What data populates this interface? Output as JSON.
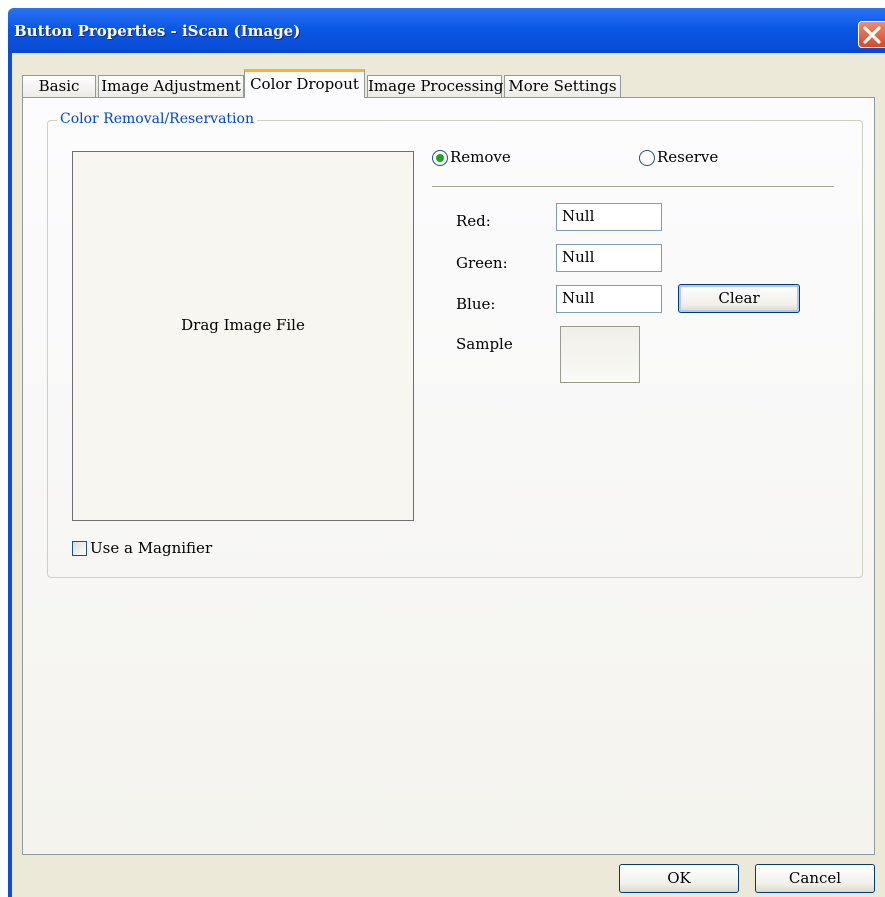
{
  "window": {
    "title": "Button Properties - iScan (Image)"
  },
  "tabs": [
    {
      "label": "Basic",
      "active": false
    },
    {
      "label": "Image Adjustment",
      "active": false
    },
    {
      "label": "Color Dropout",
      "active": true
    },
    {
      "label": "Image Processing",
      "active": false
    },
    {
      "label": "More Settings",
      "active": false
    }
  ],
  "color_removal": {
    "group_label": "Color Removal/Reservation",
    "drop_zone_text": "Drag Image File",
    "magnifier_label": "Use a Magnifier",
    "magnifier_checked": false,
    "mode_options": [
      {
        "label": "Remove",
        "selected": true
      },
      {
        "label": "Reserve",
        "selected": false
      }
    ],
    "fields": {
      "red": {
        "label": "Red:",
        "value": "Null"
      },
      "green": {
        "label": "Green:",
        "value": "Null"
      },
      "blue": {
        "label": "Blue:",
        "value": "Null"
      }
    },
    "clear_label": "Clear",
    "sample_label": "Sample"
  },
  "footer": {
    "ok_label": "OK",
    "cancel_label": "Cancel"
  },
  "colors": {
    "titlebar": "#0b58e6",
    "dialog_bg": "#ece9d8",
    "active_tab_accent": "#f9b132",
    "group_label": "#0046d5",
    "radio_dot": "#21a121",
    "close_button": "#d6482b"
  },
  "icons": {
    "close": "close-icon",
    "radio_selected": "radio-selected-icon",
    "radio_empty": "radio-empty-icon"
  }
}
